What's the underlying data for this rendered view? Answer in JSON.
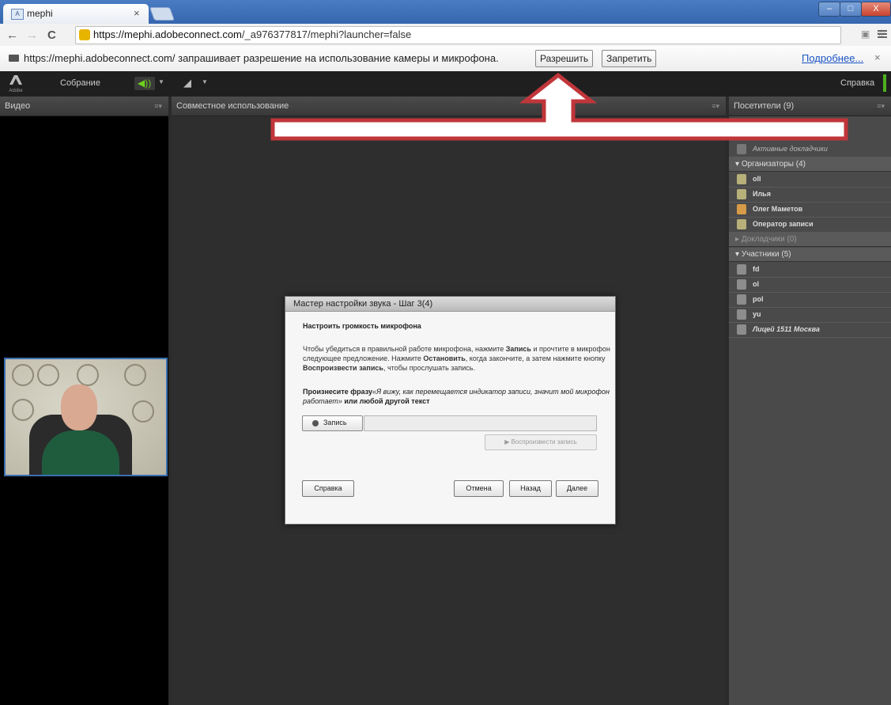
{
  "browser": {
    "tab_title": "mephi",
    "tab_close": "×",
    "url_host": "https://mephi.adobeconnect.com",
    "url_path": "/_a976377817/mephi?launcher=false",
    "nav_back": "←",
    "nav_forward": "→",
    "nav_reload": "C",
    "star": "☆",
    "win_min": "–",
    "win_max": "□",
    "win_close": "X"
  },
  "infobar": {
    "message": "https://mephi.adobeconnect.com/ запрашивает разрешение на использование камеры и микрофона.",
    "allow_label": "Разрешить",
    "deny_label": "Запретить",
    "more_link": "Подробнее...",
    "close": "×"
  },
  "menubar": {
    "logo_text": "Adobe",
    "meeting": "Собрание",
    "help": "Справка",
    "audio_icon": "speaker-icon",
    "camera_icon": "webcam-icon",
    "accent_color": "#4db01f"
  },
  "pods": {
    "video_title": "Видео",
    "share_title": "Совместное использование",
    "attendees_title": "Посетители (9)"
  },
  "attendees": {
    "active_speakers": "Активные докладчики",
    "groups": [
      {
        "label": "Организаторы (4)",
        "members": [
          "oll",
          "Илья",
          "Олег Маметов",
          "Оператор записи"
        ]
      },
      {
        "label": "Докладчики (0)",
        "members": []
      },
      {
        "label": "Участники (5)",
        "members": [
          "fd",
          "ol",
          "pol",
          "yu",
          "Лицей 1511 Москва"
        ]
      }
    ]
  },
  "dialog": {
    "title": "Мастер настройки звука - Шаг 3(4)",
    "heading": "Настроить громкость микрофона",
    "instructions_prefix": "Чтобы убедиться в правильной работе микрофона, нажмите ",
    "instructions_record": "Запись",
    "instructions_middle": " и прочтите в микрофон следующее предложение. Нажмите ",
    "instructions_stop": "Остановить",
    "instructions_middle2": ", когда закончите, а затем нажмите кнопку ",
    "instructions_play": "Воспроизвести запись",
    "instructions_suffix": ", чтобы прослушать запись.",
    "prompt_lead": "Произнесите фразу",
    "prompt_phrase": "«Я вижу, как перемещается индикатор записи, значит мой микрофон работает»",
    "prompt_tail": " или любой другой текст",
    "record_label": "Запись",
    "play_label": "▶ Воспроизвести запись",
    "help_label": "Справка",
    "cancel_label": "Отмена",
    "back_label": "Назад",
    "next_label": "Далее"
  },
  "annotation": {
    "arrow_color": "#c0363a"
  }
}
